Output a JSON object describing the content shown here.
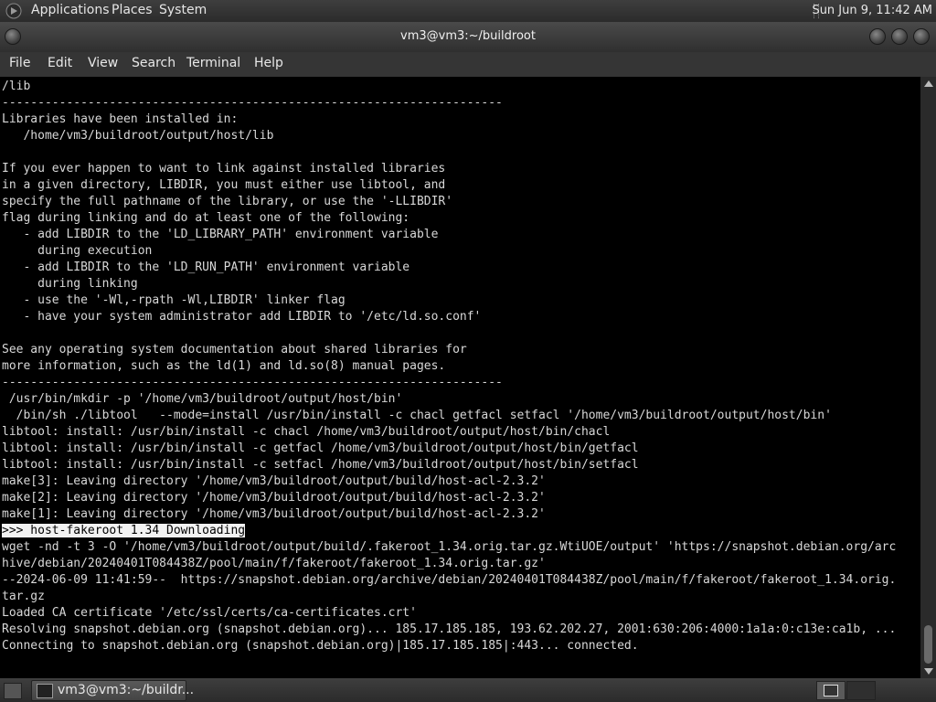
{
  "top_panel": {
    "applications_label": "Applications",
    "places_label": "Places",
    "system_label": "System",
    "clock": "Sun Jun  9, 11:42 AM"
  },
  "window": {
    "title": "vm3@vm3:~/buildroot"
  },
  "menubar": {
    "file": "File",
    "edit": "Edit",
    "view": "View",
    "search": "Search",
    "terminal": "Terminal",
    "help": "Help"
  },
  "terminal": {
    "lines_before": "/lib\n----------------------------------------------------------------------\nLibraries have been installed in:\n   /home/vm3/buildroot/output/host/lib\n\nIf you ever happen to want to link against installed libraries\nin a given directory, LIBDIR, you must either use libtool, and\nspecify the full pathname of the library, or use the '-LLIBDIR'\nflag during linking and do at least one of the following:\n   - add LIBDIR to the 'LD_LIBRARY_PATH' environment variable\n     during execution\n   - add LIBDIR to the 'LD_RUN_PATH' environment variable\n     during linking\n   - use the '-Wl,-rpath -Wl,LIBDIR' linker flag\n   - have your system administrator add LIBDIR to '/etc/ld.so.conf'\n\nSee any operating system documentation about shared libraries for\nmore information, such as the ld(1) and ld.so(8) manual pages.\n----------------------------------------------------------------------\n /usr/bin/mkdir -p '/home/vm3/buildroot/output/host/bin'\n  /bin/sh ./libtool   --mode=install /usr/bin/install -c chacl getfacl setfacl '/home/vm3/buildroot/output/host/bin'\nlibtool: install: /usr/bin/install -c chacl /home/vm3/buildroot/output/host/bin/chacl\nlibtool: install: /usr/bin/install -c getfacl /home/vm3/buildroot/output/host/bin/getfacl\nlibtool: install: /usr/bin/install -c setfacl /home/vm3/buildroot/output/host/bin/setfacl\nmake[3]: Leaving directory '/home/vm3/buildroot/output/build/host-acl-2.3.2'\nmake[2]: Leaving directory '/home/vm3/buildroot/output/build/host-acl-2.3.2'\nmake[1]: Leaving directory '/home/vm3/buildroot/output/build/host-acl-2.3.2'\n",
    "highlight_line": ">>> host-fakeroot 1.34 Downloading",
    "lines_after": "\nwget -nd -t 3 -O '/home/vm3/buildroot/output/build/.fakeroot_1.34.orig.tar.gz.WtiUOE/output' 'https://snapshot.debian.org/arc\nhive/debian/20240401T084438Z/pool/main/f/fakeroot/fakeroot_1.34.orig.tar.gz'\n--2024-06-09 11:41:59--  https://snapshot.debian.org/archive/debian/20240401T084438Z/pool/main/f/fakeroot/fakeroot_1.34.orig.\ntar.gz\nLoaded CA certificate '/etc/ssl/certs/ca-certificates.crt'\nResolving snapshot.debian.org (snapshot.debian.org)... 185.17.185.185, 193.62.202.27, 2001:630:206:4000:1a1a:0:c13e:ca1b, ...\nConnecting to snapshot.debian.org (snapshot.debian.org)|185.17.185.185|:443... connected."
  },
  "taskbar": {
    "window_button_label": "vm3@vm3:~/buildr..."
  }
}
